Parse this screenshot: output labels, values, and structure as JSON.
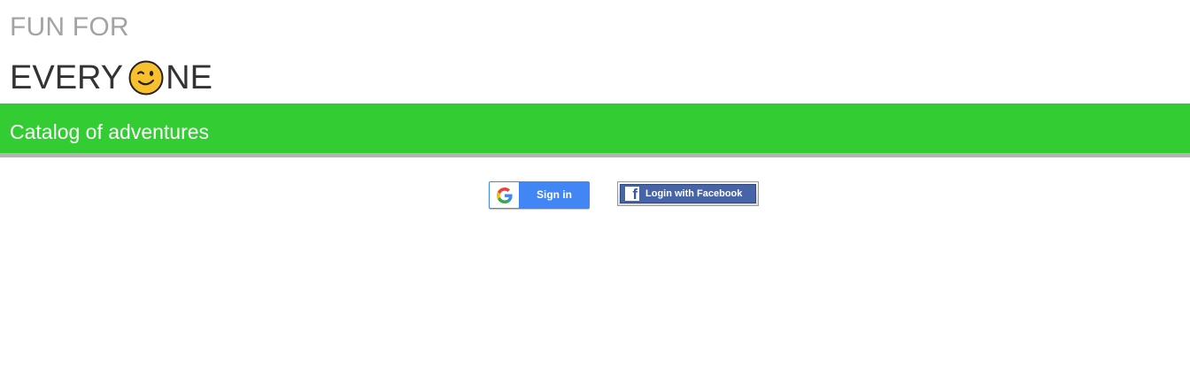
{
  "header": {
    "line1": "FUN FOR",
    "line2_before": "EVERY",
    "line2_icon": "winking-face-emoji",
    "line2_after": "NE"
  },
  "banner": {
    "title": "Catalog of adventures",
    "color": "#33cc33",
    "border_color": "#b3b3b3"
  },
  "auth": {
    "google_label": "Sign in",
    "google_icon": "google-g-icon",
    "google_color": "#4285f4",
    "facebook_label": "Login with Facebook",
    "facebook_icon": "facebook-f-icon",
    "facebook_color": "#4864a8"
  }
}
